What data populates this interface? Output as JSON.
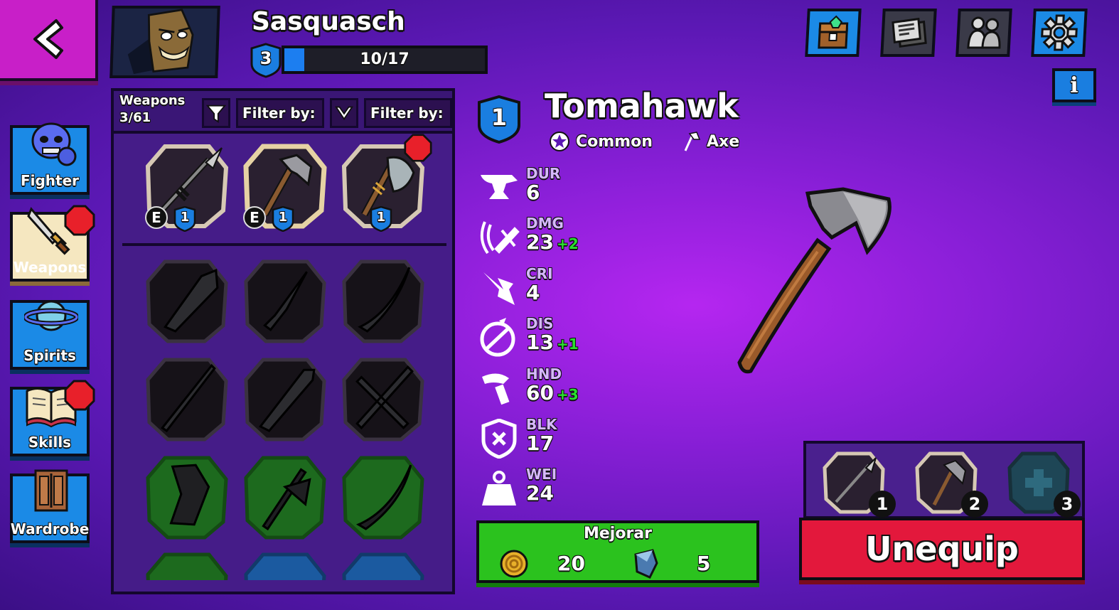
{
  "header": {
    "character_name": "Sasquasch",
    "level": "3",
    "xp_text": "10/17",
    "xp_progress": 0.1
  },
  "top_icons": [
    {
      "name": "chest-icon",
      "color": "#1b8ae6"
    },
    {
      "name": "news-icon",
      "color": "#3a3a48"
    },
    {
      "name": "friends-icon",
      "color": "#3a3a48"
    },
    {
      "name": "gear-icon",
      "color": "#1b8ae6"
    }
  ],
  "info_label": "i",
  "nav": [
    {
      "label": "Fighter",
      "icon": "fighter-icon",
      "badge": false
    },
    {
      "label": "Weapons",
      "icon": "weapons-icon",
      "badge": true
    },
    {
      "label": "Spirits",
      "icon": "spirits-icon",
      "badge": false
    },
    {
      "label": "Skills",
      "icon": "skills-icon",
      "badge": true
    },
    {
      "label": "Wardrobe",
      "icon": "wardrobe-icon",
      "badge": false
    }
  ],
  "weapons_panel": {
    "title": "Weapons",
    "count": "3/61",
    "filter1_label": "Filter by:",
    "filter2_label": "Filter by:",
    "owned": [
      {
        "name": "spear",
        "level": "1",
        "equipped_mark": "E"
      },
      {
        "name": "tomahawk",
        "level": "1",
        "equipped_mark": "E"
      },
      {
        "name": "battle-axe",
        "level": "1",
        "equipped_mark": "",
        "new": true
      }
    ]
  },
  "detail": {
    "level": "1",
    "weapon_name": "Tomahawk",
    "rarity": "Common",
    "type": "Axe",
    "stats": [
      {
        "key": "DUR",
        "value": "6",
        "bonus": "",
        "icon": "anvil-icon"
      },
      {
        "key": "DMG",
        "value": "23",
        "bonus": "+2",
        "icon": "damage-icon"
      },
      {
        "key": "CRI",
        "value": "4",
        "bonus": "",
        "icon": "critical-icon"
      },
      {
        "key": "DIS",
        "value": "13",
        "bonus": "+1",
        "icon": "disarm-icon"
      },
      {
        "key": "HND",
        "value": "60",
        "bonus": "+3",
        "icon": "handling-icon"
      },
      {
        "key": "BLK",
        "value": "17",
        "bonus": "",
        "icon": "block-icon"
      },
      {
        "key": "WEI",
        "value": "24",
        "bonus": "",
        "icon": "weight-icon"
      }
    ]
  },
  "upgrade": {
    "label": "Mejorar",
    "coin_cost": "20",
    "gem_cost": "5"
  },
  "loadout": {
    "slots": [
      {
        "number": "1",
        "weapon": "spear"
      },
      {
        "number": "2",
        "weapon": "tomahawk"
      },
      {
        "number": "3",
        "weapon": "empty"
      }
    ]
  },
  "unequip_label": "Unequip",
  "colors": {
    "panel": "#451c88",
    "blue": "#1b8ae6",
    "green": "#2bc21e",
    "red": "#e3183c",
    "bonus": "#29e02e"
  }
}
